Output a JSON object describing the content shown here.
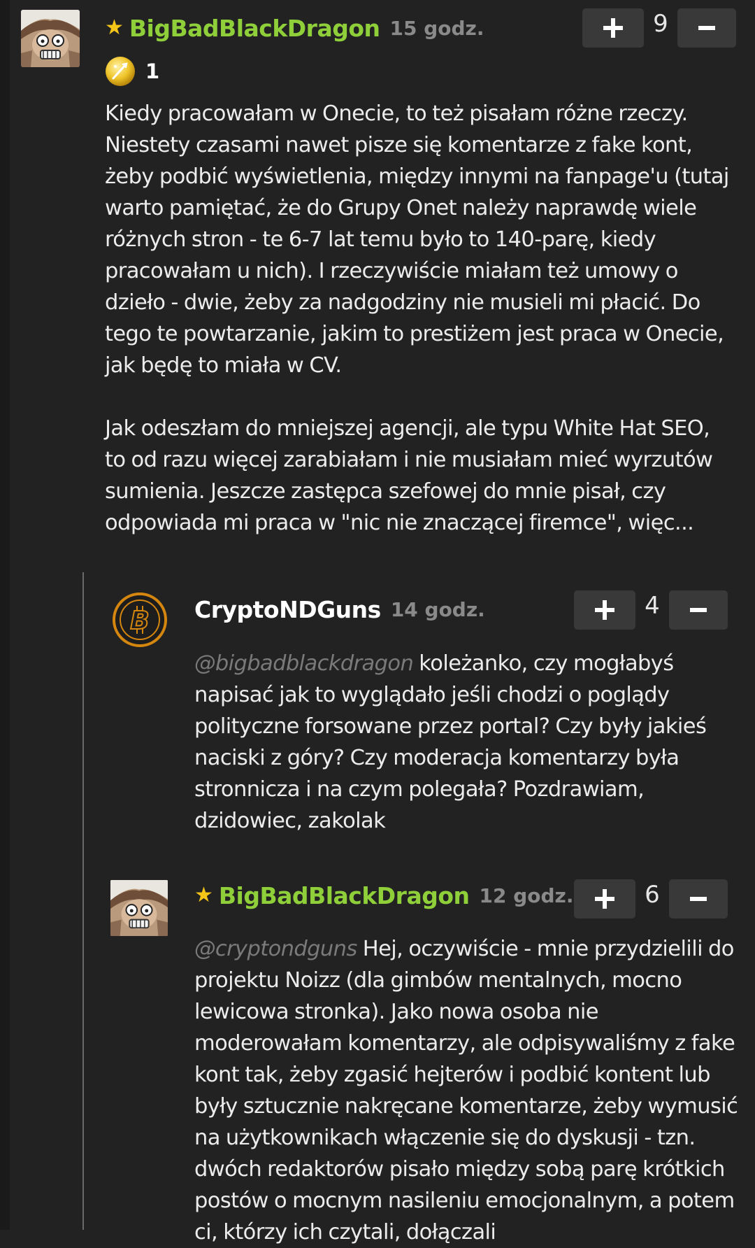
{
  "colors": {
    "background": "#222222",
    "username_green": "#8fcf3a",
    "time_gray": "#8a8a8a",
    "mention_gray": "#7a7a7a",
    "vote_button_bg": "#393939",
    "star": "#f5c518",
    "bitcoin_orange": "#d4860f"
  },
  "comments": [
    {
      "username": "BigBadBlackDragon",
      "time": "15 godz.",
      "votes": "9",
      "avatar_icon": "anime-avatar-icon",
      "badge": {
        "icon": "gold-medal-icon",
        "count": "1"
      },
      "paragraphs": [
        "Kiedy pracowałam w Onecie, to też pisałam różne rzeczy. Niestety czasami nawet pisze się komentarze z fake kont, żeby podbić wyświetlenia, między innymi na fanpage'u (tutaj warto pamiętać, że do Grupy Onet należy naprawdę wiele różnych stron - te 6-7 lat temu było to 140-parę, kiedy pracowałam u nich). I rzeczywiście miałam też umowy o dzieło - dwie, żeby za nadgodziny nie musieli mi płacić. Do tego te powtarzanie, jakim to prestiżem jest praca w Onecie, jak będę to miała w CV.",
        "Jak odeszłam do mniejszej agencji, ale typu White Hat SEO, to od razu więcej zarabiałam i nie musiałam mieć wyrzutów sumienia. Jeszcze zastępca szefowej do mnie pisał, czy odpowiada mi praca w \"nic nie znaczącej firemce\", więc..."
      ]
    },
    {
      "username": "CryptoNDGuns",
      "time": "14 godz.",
      "votes": "4",
      "avatar_icon": "bitcoin-avatar-icon",
      "mention": "@bigbadblackdragon",
      "text": " koleżanko, czy mogłabyś napisać jak to wyglądało jeśli chodzi o poglądy polityczne forsowane przez portal? Czy były jakieś naciski z góry? Czy moderacja komentarzy była stronnicza i na czym polegała? Pozdrawiam, dzidowiec, zakolak"
    },
    {
      "username": "BigBadBlackDragon",
      "time": "12 godz.",
      "votes": "6",
      "avatar_icon": "anime-avatar-icon",
      "mention": "@cryptondguns",
      "text": " Hej, oczywiście - mnie przydzielili do projektu Noizz (dla gimbów mentalnych, mocno lewicowa stronka). Jako nowa osoba nie moderowałam komentarzy, ale odpisywaliśmy z fake kont tak, żeby zgasić hejterów i podbić kontent lub były sztucznie nakręcane komentarze, żeby wymusić na użytkownikach włączenie się do dyskusji - tzn. dwóch redaktorów pisało między sobą parę krótkich postów o mocnym nasileniu emocjonalnym, a potem ci, którzy ich czytali, dołączali"
    }
  ]
}
